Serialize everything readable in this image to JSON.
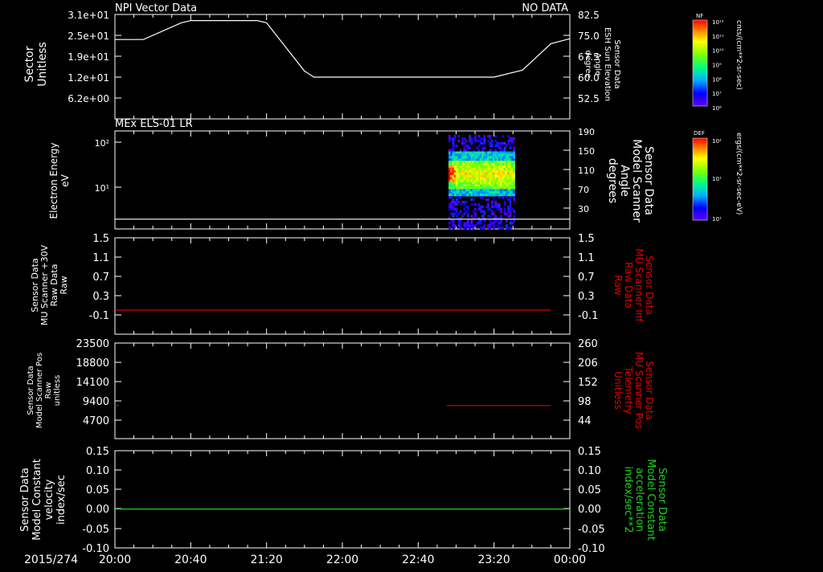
{
  "colors": {
    "background": "#000000",
    "axis": "#ffffff",
    "red_series": "#e00000",
    "green_series": "#20d020"
  },
  "chart_data": [
    {
      "type": "line",
      "title_left": "NPI Vector Data",
      "title_right": "NO DATA",
      "ylabel_left": [
        "Sector",
        "Unitless"
      ],
      "ylabel_right": [
        "Sensor Data",
        "ESH Sun Elevation",
        "Angle",
        "degree"
      ],
      "left_ticks": [
        "3.1e+01",
        "2.5e+01",
        "1.9e+01",
        "1.2e+01",
        "6.2e+00"
      ],
      "right_ticks": [
        "82.5",
        "75.0",
        "67.5",
        "60.0",
        "52.5"
      ],
      "right_ylim": [
        45,
        82.5
      ],
      "series": [
        {
          "color": "#ffffff",
          "x": [
            "20:00",
            "20:15",
            "20:35",
            "20:40",
            "21:15",
            "21:20",
            "21:40",
            "21:45",
            "23:20",
            "23:35",
            "23:50",
            "24:00"
          ],
          "values": [
            73.5,
            73.5,
            79.5,
            80.3,
            80.3,
            79.5,
            62.2,
            60.0,
            60.0,
            62.5,
            72,
            73.8
          ]
        }
      ]
    },
    {
      "type": "heatmap",
      "title": "MEx ELS-01 LR",
      "ylabel_left": [
        "Electron Energy",
        "eV"
      ],
      "ylabel_right": [
        "Sensor Data",
        "Model Scanner",
        "Angle",
        "degrees"
      ],
      "left_ticks": [
        "10²",
        "10¹"
      ],
      "right_ticks": [
        "190",
        "150",
        "110",
        "70",
        "30"
      ],
      "right_ylim": [
        0,
        190
      ],
      "heatmap_x_range": [
        "22:56",
        "23:31"
      ],
      "heatmap_y_range": [
        -10,
        150
      ],
      "peak_band_center": 100,
      "series": [
        {
          "color": "#ffffff",
          "x": [
            "20:00",
            "24:00"
          ],
          "values": [
            7,
            7
          ]
        }
      ]
    },
    {
      "type": "line",
      "ylabel_left": [
        "Sensor Data",
        "MU Scanner +30V",
        "Raw Data",
        "Raw"
      ],
      "ylabel_right": [
        "Sensor Data",
        "MU Scanner Inf",
        "Raw Data",
        "Raw"
      ],
      "left_ticks": [
        "1.5",
        "1.1",
        "0.7",
        "0.3",
        "-0.1"
      ],
      "right_ticks": [
        "1.5",
        "1.1",
        "0.7",
        "0.3",
        "-0.1"
      ],
      "ylim": [
        -0.3,
        1.5
      ],
      "series": [
        {
          "color": "#e00000",
          "x": [
            "20:00",
            "23:50"
          ],
          "values": [
            0,
            0
          ]
        }
      ]
    },
    {
      "type": "line",
      "ylabel_left": [
        "Sensor Data",
        "Model Scanner Pos",
        "Raw",
        "unitless"
      ],
      "ylabel_right": [
        "Sensor Data",
        "MU Scanner Pos",
        "Telemetry",
        "Unitless"
      ],
      "left_ticks": [
        "23500",
        "18800",
        "14100",
        "9400",
        "4700"
      ],
      "right_ticks": [
        "260",
        "206",
        "152",
        "98",
        "44"
      ],
      "right_ylim": [
        0,
        260
      ],
      "series": [
        {
          "color": "#e00000",
          "x": [
            "20:00",
            "20:02"
          ],
          "values": [
            85,
            85
          ]
        },
        {
          "color": "#e00000",
          "x": [
            "22:55",
            "23:50"
          ],
          "values": [
            85,
            85
          ]
        }
      ]
    },
    {
      "type": "line",
      "ylabel_left": [
        "Sensor Data",
        "Model Constant",
        "velocity",
        "index/sec"
      ],
      "ylabel_right": [
        "Sensor Data",
        "Model Constant",
        "acceleration",
        "index/sec**2"
      ],
      "left_ticks": [
        "0.15",
        "0.10",
        "0.05",
        "0.00",
        "-0.05",
        "-0.10"
      ],
      "right_ticks": [
        "0.15",
        "0.10",
        "0.05",
        "0.00",
        "-0.05",
        "-0.10"
      ],
      "ylim": [
        -0.1,
        0.15
      ],
      "series": [
        {
          "color": "#20d020",
          "x": [
            "20:00",
            "24:00"
          ],
          "values": [
            0,
            0
          ]
        }
      ]
    }
  ],
  "x_axis": {
    "date": "2015/274",
    "ticks": [
      "20:00",
      "20:40",
      "21:20",
      "22:00",
      "22:40",
      "23:20",
      "00:00"
    ]
  },
  "colorbars": [
    {
      "label": "NF",
      "unit": "cnts/(cm**2-sr-sec)",
      "ticks": [
        "10¹²",
        "10¹¹",
        "10¹⁰",
        "10⁹",
        "10⁸",
        "10⁷",
        "10⁶"
      ]
    },
    {
      "label": "DEF",
      "unit": "ergs/(cm**2-sr-sec-eV)",
      "ticks": [
        "10²",
        "10¹",
        "10¹"
      ]
    }
  ]
}
